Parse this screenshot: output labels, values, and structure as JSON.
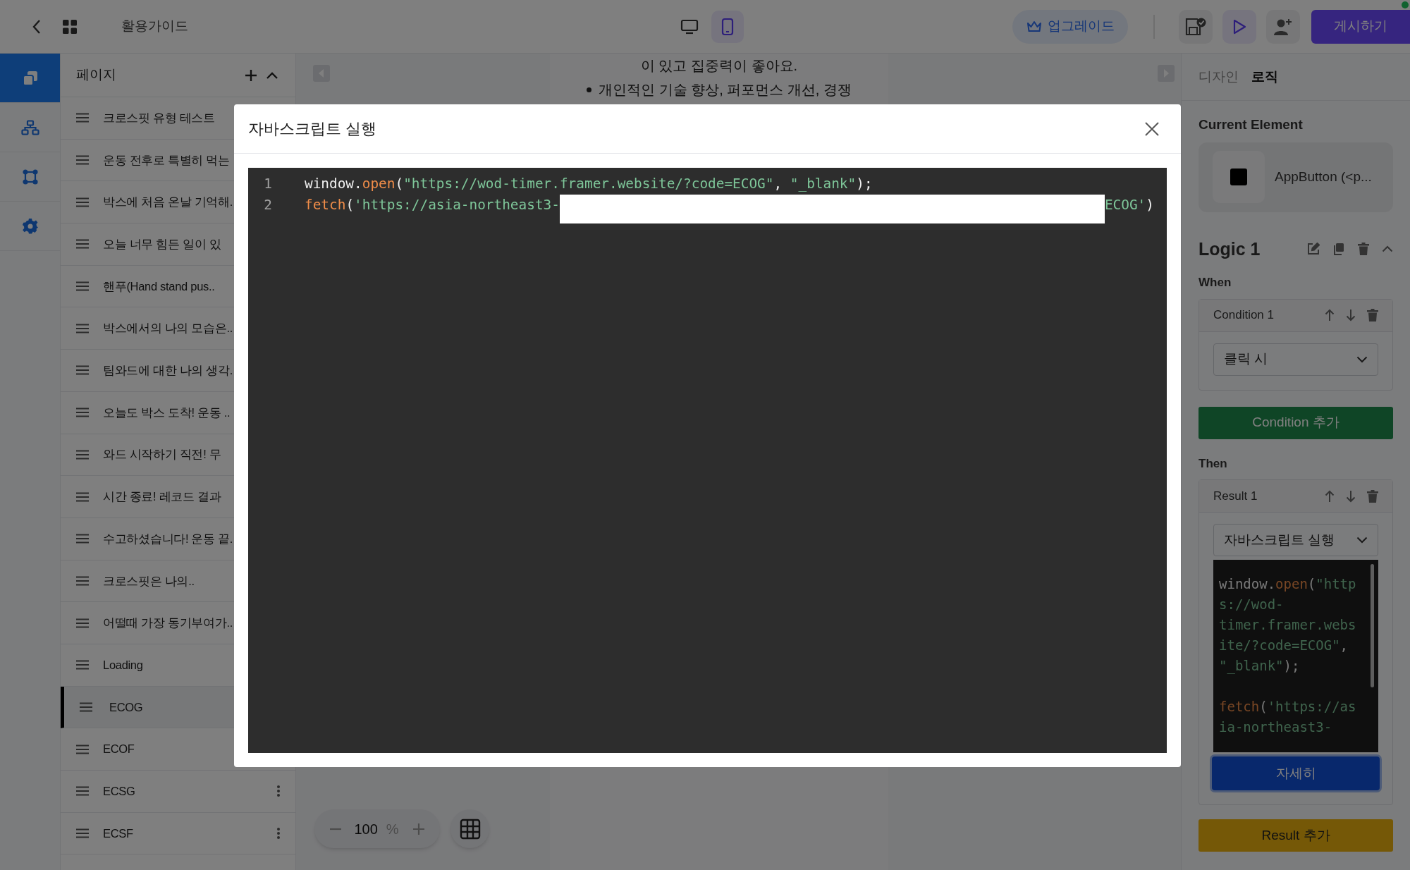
{
  "top_bar": {
    "title": "활용가이드",
    "devices": [
      {
        "kind": "desktop",
        "selected": false
      },
      {
        "kind": "mobile",
        "selected": true
      }
    ],
    "upgrade_button": "업그레이드",
    "publish_button": "게시하기"
  },
  "rail": [
    {
      "kind": "pages",
      "selected": true
    },
    {
      "kind": "sitemap",
      "selected": false
    },
    {
      "kind": "frame",
      "selected": false
    },
    {
      "kind": "settings",
      "selected": false
    }
  ],
  "pages_panel": {
    "title": "페이지",
    "pages": [
      {
        "label": "크로스핏 유형 테스트",
        "selected": false
      },
      {
        "label": "운동 전후로 특별히 먹는",
        "selected": false
      },
      {
        "label": "박스에 처음 온날 기억해.",
        "selected": false
      },
      {
        "label": "오늘 너무 힘든 일이 있",
        "selected": false
      },
      {
        "label": "핸푸(Hand stand pus..",
        "selected": false
      },
      {
        "label": "박스에서의 나의 모습은..",
        "selected": false
      },
      {
        "label": "팀와드에 대한 나의 생각.",
        "selected": false
      },
      {
        "label": "오늘도 박스 도착! 운동 ..",
        "selected": false
      },
      {
        "label": "와드 시작하기 직전! 무",
        "selected": false
      },
      {
        "label": "시간 종료! 레코드 결과",
        "selected": false
      },
      {
        "label": "수고하셨습니다! 운동 끝.",
        "selected": false
      },
      {
        "label": "크로스핏은 나의..",
        "selected": false
      },
      {
        "label": "어떨때 가장 동기부여가..",
        "selected": false
      },
      {
        "label": "Loading",
        "selected": false
      },
      {
        "label": "ECOG",
        "selected": true
      },
      {
        "label": "ECOF",
        "selected": false
      },
      {
        "label": "ECSG",
        "selected": false,
        "menu": true
      },
      {
        "label": "ECSF",
        "selected": false,
        "menu": true
      }
    ]
  },
  "canvas": {
    "lines": [
      {
        "text": "이 있고 집중력이 좋아요.",
        "bullet": false
      },
      {
        "text": "개인적인 기술 향상, 퍼포먼스 개선, 경쟁",
        "bullet": true
      }
    ],
    "zoom": "100",
    "zoom_unit": "%"
  },
  "inspector": {
    "tabs": [
      {
        "label": "디자인",
        "selected": false
      },
      {
        "label": "로직",
        "selected": true
      }
    ],
    "current_element_heading": "Current Element",
    "current_element": "AppButton (<p...",
    "logic_title": "Logic 1",
    "when_label": "When",
    "condition": {
      "title": "Condition 1",
      "select": "클릭 시"
    },
    "add_condition": "Condition 추가",
    "then_label": "Then",
    "result": {
      "title": "Result 1",
      "select": "자바스크립트 실행",
      "code_preview": [
        {
          "lines": [
            [
              {
                "t": "window.",
                "kind": "plain"
              },
              {
                "t": "open",
                "kind": "fn"
              },
              {
                "t": "(",
                "kind": "plain"
              },
              {
                "t": "\"http",
                "kind": "str"
              }
            ],
            [
              {
                "t": "s://wod-",
                "kind": "str"
              }
            ],
            [
              {
                "t": "timer.framer.webs",
                "kind": "str"
              }
            ],
            [
              {
                "t": "ite/?code=ECOG\"",
                "kind": "str"
              },
              {
                "t": ",",
                "kind": "plain"
              }
            ],
            [
              {
                "t": "\"_blank\"",
                "kind": "str"
              },
              {
                "t": ");",
                "kind": "plain"
              }
            ]
          ]
        },
        {
          "lines": [
            [
              {
                "t": "fetch",
                "kind": "fn"
              },
              {
                "t": "(",
                "kind": "plain"
              },
              {
                "t": "'https://as",
                "kind": "str"
              }
            ],
            [
              {
                "t": "ia-northeast3-",
                "kind": "str"
              }
            ]
          ]
        }
      ],
      "details_button": "자세히"
    },
    "add_result": "Result 추가"
  },
  "modal": {
    "title": "자바스크립트 실행",
    "lines": [
      {
        "number": "1",
        "tokens": [
          {
            "t": "window.",
            "kind": "plain"
          },
          {
            "t": "open",
            "kind": "fn"
          },
          {
            "t": "(",
            "kind": "plain"
          },
          {
            "t": "\"https://wod-timer.framer.website/?code=ECOG\"",
            "kind": "str"
          },
          {
            "t": ", ",
            "kind": "plain"
          },
          {
            "t": "\"_blank\"",
            "kind": "str"
          },
          {
            "t": ");",
            "kind": "plain"
          }
        ]
      },
      {
        "number": "2",
        "tokens": [
          {
            "t": "fetch",
            "kind": "fn"
          },
          {
            "t": "(",
            "kind": "plain"
          },
          {
            "t": "'https://asia-northeast3-",
            "kind": "str"
          },
          {
            "kind": "redacted"
          },
          {
            "t": "ECOG'",
            "kind": "str"
          },
          {
            "t": ")",
            "kind": "plain"
          }
        ]
      }
    ]
  }
}
